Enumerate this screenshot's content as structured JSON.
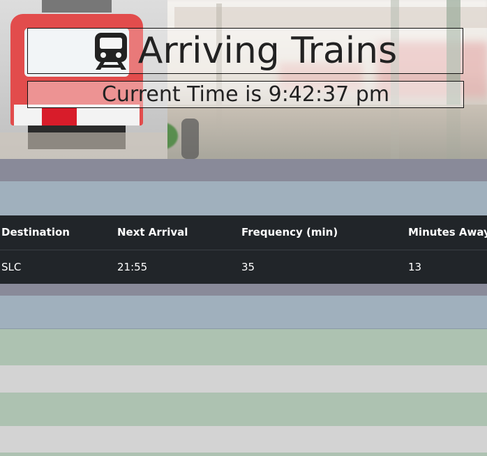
{
  "header": {
    "title": "Arriving Trains",
    "time_prefix": "Current Time is ",
    "current_time": "9:42:37 pm",
    "title_icon": "train-icon"
  },
  "table": {
    "columns": [
      "Destination",
      "Next Arrival",
      "Frequency (min)",
      "Minutes Away"
    ],
    "rows": [
      [
        "SLC",
        "21:55",
        "35",
        "13"
      ]
    ]
  },
  "colors": {
    "table_bg": "#212529",
    "stripe_gray": "#898a99",
    "stripe_blue": "#a0b0bd",
    "stripe_green": "#adc2b1",
    "stripe_light": "#d3d3d3"
  }
}
